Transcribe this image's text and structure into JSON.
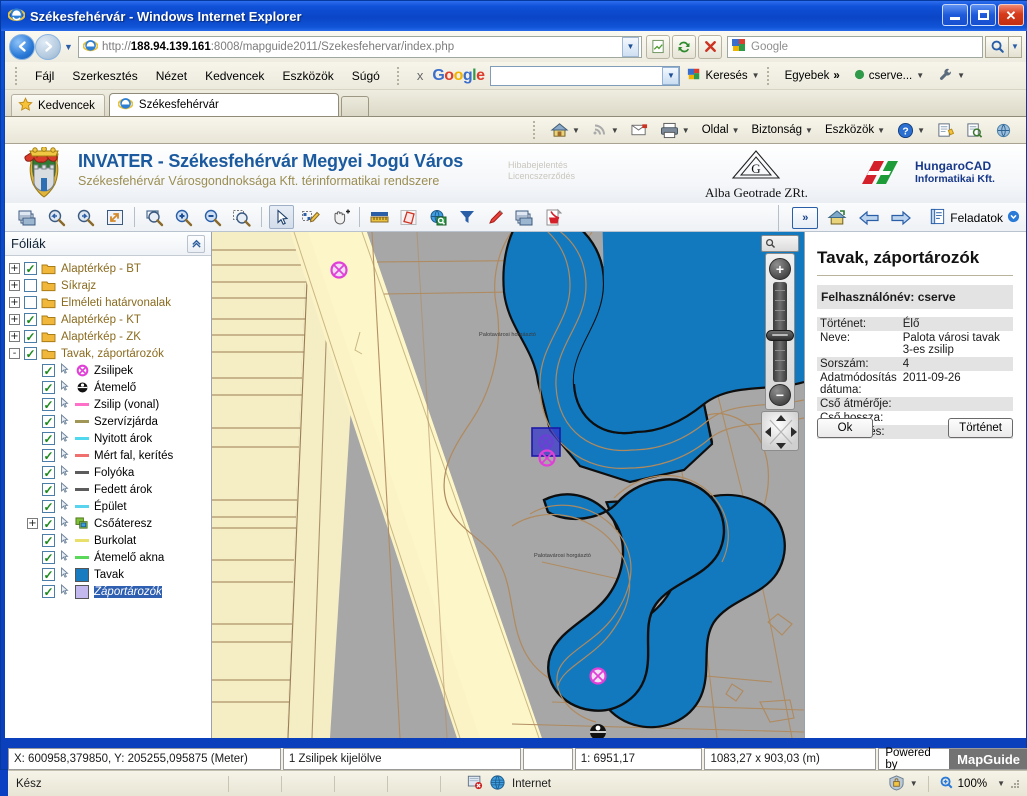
{
  "window": {
    "title": "Székesfehérvár - Windows Internet Explorer",
    "minimize_label": "Kis méret",
    "maximize_label": "Teljes méret",
    "close_label": "Bezárás"
  },
  "nav": {
    "back_label": "Vissza",
    "forward_label": "Előre",
    "recent_label": "Legutóbbi oldalak",
    "url_prefix": "http://",
    "url_host": "188.94.139.161",
    "url_rest": ":8008/mapguide2011/Szekesfehervar/index.php",
    "url_full": "http://188.94.139.161:8008/mapguide2011/Szekesfehervar/index.php",
    "compat_label": "Kompatibilitási nézet",
    "refresh_label": "Frissítés",
    "stop_label": "Leállítás",
    "search_placeholder": "Google",
    "search_value": "",
    "search_go_label": "Keresés"
  },
  "menu": {
    "items": [
      {
        "label": "Fájl",
        "accel": "F"
      },
      {
        "label": "Szerkesztés",
        "accel": "z"
      },
      {
        "label": "Nézet",
        "accel": "v"
      },
      {
        "label": "Kedvencek",
        "accel": "K"
      },
      {
        "label": "Eszközök",
        "accel": "ö"
      },
      {
        "label": "Súgó",
        "accel": "g"
      }
    ]
  },
  "gtoolbar": {
    "close_label": "x",
    "logo": [
      "G",
      "o",
      "o",
      "g",
      "l",
      "e"
    ],
    "field_value": "",
    "search_label": "Keresés",
    "more_label": "Egyebek",
    "more_chevron": "»",
    "account_label": "cserve...",
    "wrench_label": "Beállítások"
  },
  "favbar": {
    "favorites_label": "Kedvencek",
    "tab_label": "Székesfehérvár",
    "newtab_label": "Új lap"
  },
  "cmdbar": {
    "home_label": "Kezdőlap",
    "feeds_label": "Hírcsatornák",
    "mail_label": "Olvasás levélben",
    "print_label": "Nyomtatás",
    "page_label": "Oldal",
    "safety_label": "Biztonság",
    "tools_label": "Eszközök",
    "help_label": "Súgó",
    "extra1_label": "Hozzáadás",
    "extra2_label": "Keresés",
    "extra3_label": "Letöltések"
  },
  "appheader": {
    "title": "INVATER - Székesfehérvár Megyei Jogú Város",
    "subtitle": "Székesfehérvár Városgondnoksága Kft. térinformatikai rendszere",
    "links": [
      "Hibabejelentés",
      "Licencszerződés"
    ],
    "alba_logo": "Alba Geotrade ZRt.",
    "hungarocad_line1": "HungaroCAD",
    "hungarocad_line2": "Informatikai Kft.",
    "crest_label": "Székesfehérvár címere"
  },
  "apptoolbar": {
    "items": [
      {
        "name": "print-icon",
        "title": "Nyomtatás"
      },
      {
        "name": "zoom-previous-icon",
        "title": "Előző nézet"
      },
      {
        "name": "zoom-next-icon",
        "title": "Következő nézet"
      },
      {
        "name": "zoom-extent-icon",
        "title": "Teljes kiterjedés"
      },
      {
        "name": "zoom-rectangle-icon",
        "title": "Nagyítás területre"
      },
      {
        "name": "zoom-in-icon",
        "title": "Nagyítás"
      },
      {
        "name": "zoom-out-icon",
        "title": "Kicsinyítés"
      },
      {
        "name": "zoom-selection-icon",
        "title": "Nagyítás kijelölésre"
      },
      {
        "name": "select-arrow-icon",
        "title": "Kijelölés",
        "selected": true
      },
      {
        "name": "select-edit-icon",
        "title": "Kijelölés szerkesztése"
      },
      {
        "name": "pan-hand-icon",
        "title": "Eltolás"
      },
      {
        "name": "measure-icon",
        "title": "Mérés"
      },
      {
        "name": "redline-icon",
        "title": "Rajzelem"
      },
      {
        "name": "search-globe-icon",
        "title": "Keresés"
      },
      {
        "name": "filter-icon",
        "title": "Szűrő"
      },
      {
        "name": "pencil-icon",
        "title": "Szerkesztés"
      },
      {
        "name": "plot-icon",
        "title": "Nyomtatási kép"
      },
      {
        "name": "pdf-icon",
        "title": "PDF export"
      }
    ],
    "right_items": [
      {
        "name": "expand-icon",
        "label": "»"
      },
      {
        "name": "home-icon",
        "label": ""
      },
      {
        "name": "back-arrow-icon",
        "label": ""
      },
      {
        "name": "forward-arrow-icon",
        "label": ""
      }
    ],
    "tasks_label": "Feladatok"
  },
  "layers": {
    "panel_title": "Fóliák",
    "collapse_label": "Összecsukás",
    "tree": [
      {
        "expander": "+",
        "checked": true,
        "type": "folder",
        "label": "Alaptérkép - BT",
        "indent": 0
      },
      {
        "expander": "+",
        "checked": false,
        "type": "folder",
        "label": "Síkrajz",
        "indent": 0
      },
      {
        "expander": "+",
        "checked": false,
        "type": "folder",
        "label": "Elméleti határvonalak",
        "indent": 0
      },
      {
        "expander": "+",
        "checked": true,
        "type": "folder",
        "label": "Alaptérkép - KT",
        "indent": 0
      },
      {
        "expander": "+",
        "checked": true,
        "type": "folder",
        "label": "Alaptérkép - ZK",
        "indent": 0
      },
      {
        "expander": "-",
        "checked": true,
        "type": "folder",
        "label": "Tavak, záportározók",
        "indent": 0
      },
      {
        "expander": "",
        "checked": true,
        "type": "point-circle-x",
        "color": "#e040d8",
        "label": "Zsilipek",
        "indent": 1
      },
      {
        "expander": "",
        "checked": true,
        "type": "point-circle-black",
        "color": "#111111",
        "label": "Átemelő",
        "indent": 1
      },
      {
        "expander": "",
        "checked": true,
        "type": "line",
        "color": "#ff70c8",
        "label": "Zsilip (vonal)",
        "indent": 1
      },
      {
        "expander": "",
        "checked": true,
        "type": "line",
        "color": "#a09656",
        "label": "Szervízjárda",
        "indent": 1
      },
      {
        "expander": "",
        "checked": true,
        "type": "line",
        "color": "#4fd8ee",
        "label": "Nyitott árok",
        "indent": 1
      },
      {
        "expander": "",
        "checked": true,
        "type": "line",
        "color": "#f07070",
        "label": "Mért fal, kerítés",
        "indent": 1
      },
      {
        "expander": "",
        "checked": true,
        "type": "line",
        "color": "#5c5c5c",
        "label": "Folyóka",
        "indent": 1
      },
      {
        "expander": "",
        "checked": true,
        "type": "line",
        "color": "#5c5c5c",
        "label": "Fedett árok",
        "indent": 1
      },
      {
        "expander": "",
        "checked": true,
        "type": "line",
        "color": "#58d4ee",
        "label": "Épület",
        "indent": 1
      },
      {
        "expander": "+",
        "checked": true,
        "type": "group-small",
        "color": "#7fc13a",
        "label": "Csőáteresz",
        "indent": 1
      },
      {
        "expander": "",
        "checked": true,
        "type": "line",
        "color": "#e8e06a",
        "label": "Burkolat",
        "indent": 1
      },
      {
        "expander": "",
        "checked": true,
        "type": "line",
        "color": "#5ad85a",
        "label": "Átemelő akna",
        "indent": 1
      },
      {
        "expander": "",
        "checked": true,
        "type": "fill",
        "color": "#1a7cc0",
        "label": "Tavak",
        "indent": 1
      },
      {
        "expander": "",
        "checked": true,
        "type": "fill",
        "color": "#c3b9ef",
        "label": "Záportározók",
        "indent": 1,
        "selected": true
      }
    ]
  },
  "map": {
    "lake_label_north": "Palotavárosi horgásztó",
    "lake_label_south": "Palotavárosi horgásztó",
    "zoom_in_label": "+",
    "zoom_out_label": "−",
    "zoom_search_label": "Keresés a térképen",
    "pan_label": "Eltolás",
    "colors": {
      "water": "#1279bf",
      "ground": "#a7a7a7",
      "parcel": "#f5edc4",
      "road": "#fdf6c8",
      "parcel_line": "#9a7d55",
      "selection": "#3333cc",
      "sluice": "#e040d8"
    }
  },
  "info": {
    "title": "Tavak, záportározók",
    "user_label": "Felhasználónév: cserve",
    "rows": [
      {
        "key": "Történet:",
        "value": "Élő"
      },
      {
        "key": "Neve:",
        "value": "Palota városi tavak 3-es zsilip"
      },
      {
        "key": "Sorszám:",
        "value": "4"
      },
      {
        "key": "Adatmódosítás dátuma:",
        "value": "2011-09-26"
      },
      {
        "key": "Cső átmérője:",
        "value": ""
      },
      {
        "key": "Cső hossza:",
        "value": ""
      },
      {
        "key": "Megjegyzés:",
        "value": ""
      }
    ],
    "ok_label": "Ok",
    "history_label": "Történet"
  },
  "mapstatus": {
    "coords": "X: 600958,379850, Y: 205255,095875 (Meter)",
    "selection": "1 Zsilipek kijelölve",
    "spacer": "",
    "scale": "1: 6951,17",
    "extent": "1083,27 x 903,03 (m)",
    "powered_by": "Powered by",
    "mapguide": "MapGuide"
  },
  "iestatus": {
    "ready": "Kész",
    "zone": "Internet",
    "zoom": "100%",
    "protected_label": "Védett mód: kikapcsolva"
  }
}
